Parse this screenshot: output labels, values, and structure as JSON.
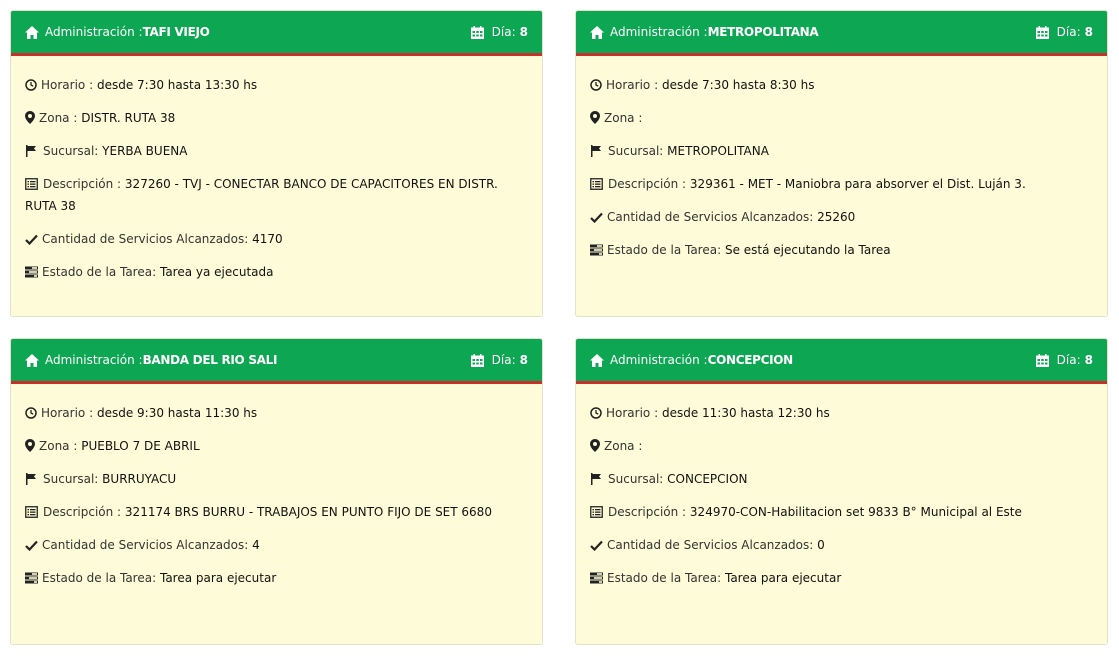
{
  "common": {
    "admin_label": "Administración :",
    "day_label": "Día:",
    "horario_label": "Horario :",
    "zona_label": "Zona :",
    "sucursal_label": "Sucursal:",
    "descripcion_label": "Descripción :",
    "servicios_label": "Cantidad de Servicios Alcanzados:",
    "estado_label": "Estado de la Tarea:"
  },
  "colors": {
    "header_green": "#0da653",
    "header_border_red": "#c9302c",
    "card_bg": "#fefcd8"
  },
  "cards": [
    {
      "admin": "TAFI VIEJO",
      "day": "8",
      "horario": "desde 7:30 hasta 13:30 hs",
      "zona": "DISTR. RUTA 38",
      "sucursal": "YERBA BUENA",
      "descripcion": "327260 - TVJ - CONECTAR BANCO DE CAPACITORES EN DISTR. RUTA 38",
      "servicios": "4170",
      "estado": "Tarea ya ejecutada"
    },
    {
      "admin": "METROPOLITANA",
      "day": "8",
      "horario": "desde 7:30 hasta 8:30 hs",
      "zona": "",
      "sucursal": "METROPOLITANA",
      "descripcion": "329361 - MET - Maniobra para absorver el Dist. Luján 3.",
      "servicios": "25260",
      "estado": "Se está ejecutando la Tarea"
    },
    {
      "admin": "BANDA DEL RIO SALI",
      "day": "8",
      "horario": "desde 9:30 hasta 11:30 hs",
      "zona": "PUEBLO 7 DE ABRIL",
      "sucursal": "BURRUYACU",
      "descripcion": "321174 BRS BURRU - TRABAJOS EN PUNTO FIJO DE SET 6680",
      "servicios": "4",
      "estado": "Tarea para ejecutar"
    },
    {
      "admin": "CONCEPCION",
      "day": "8",
      "horario": "desde 11:30 hasta 12:30 hs",
      "zona": "",
      "sucursal": "CONCEPCION",
      "descripcion": "324970-CON-Habilitacion set 9833 B° Municipal al Este",
      "servicios": "0",
      "estado": "Tarea para ejecutar"
    }
  ]
}
